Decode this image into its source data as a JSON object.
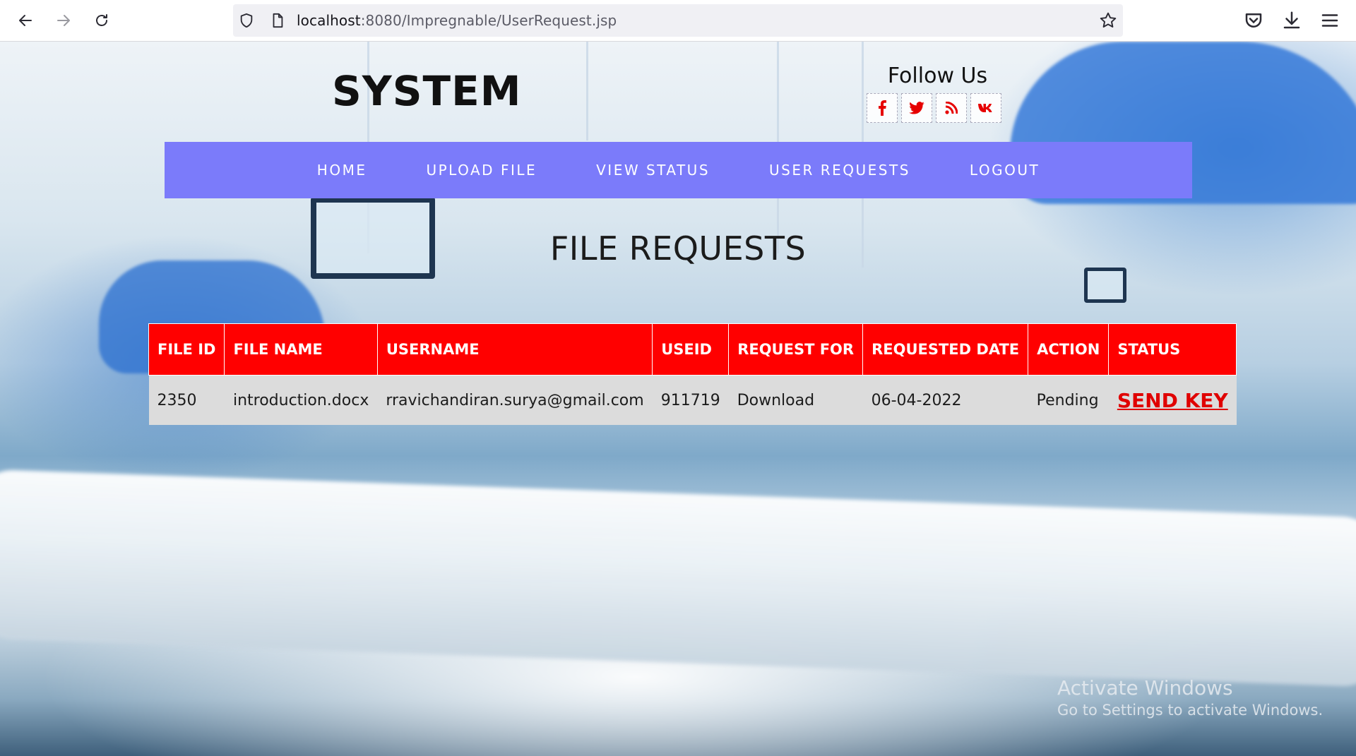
{
  "browser": {
    "url_host": "localhost",
    "url_path": ":8080/Impregnable/UserRequest.jsp"
  },
  "site": {
    "title": "SYSTEM",
    "follow_us": "Follow Us",
    "social": [
      "f",
      "t",
      "rss",
      "vk"
    ]
  },
  "nav": {
    "home": "HOME",
    "upload": "UPLOAD FILE",
    "view_status": "VIEW STATUS",
    "user_requests": "USER REQUESTS",
    "logout": "LOGOUT"
  },
  "heading": "FILE REQUESTS",
  "table": {
    "headers": [
      "FILE ID",
      "FILE NAME",
      "USERNAME",
      "USEID",
      "REQUEST FOR",
      "REQUESTED DATE",
      "ACTION",
      "STATUS"
    ],
    "rows": [
      [
        "2350",
        "introduction.docx",
        "rravichandiran.surya@gmail.com",
        "911719",
        "Download",
        "06-04-2022",
        "Pending",
        "SEND KEY"
      ]
    ]
  },
  "watermark": {
    "line1": "Activate Windows",
    "line2": "Go to Settings to activate Windows."
  },
  "colors": {
    "nav_bg": "#7b7bfa",
    "table_header_bg": "#ff0000",
    "link_red": "#e00000"
  }
}
